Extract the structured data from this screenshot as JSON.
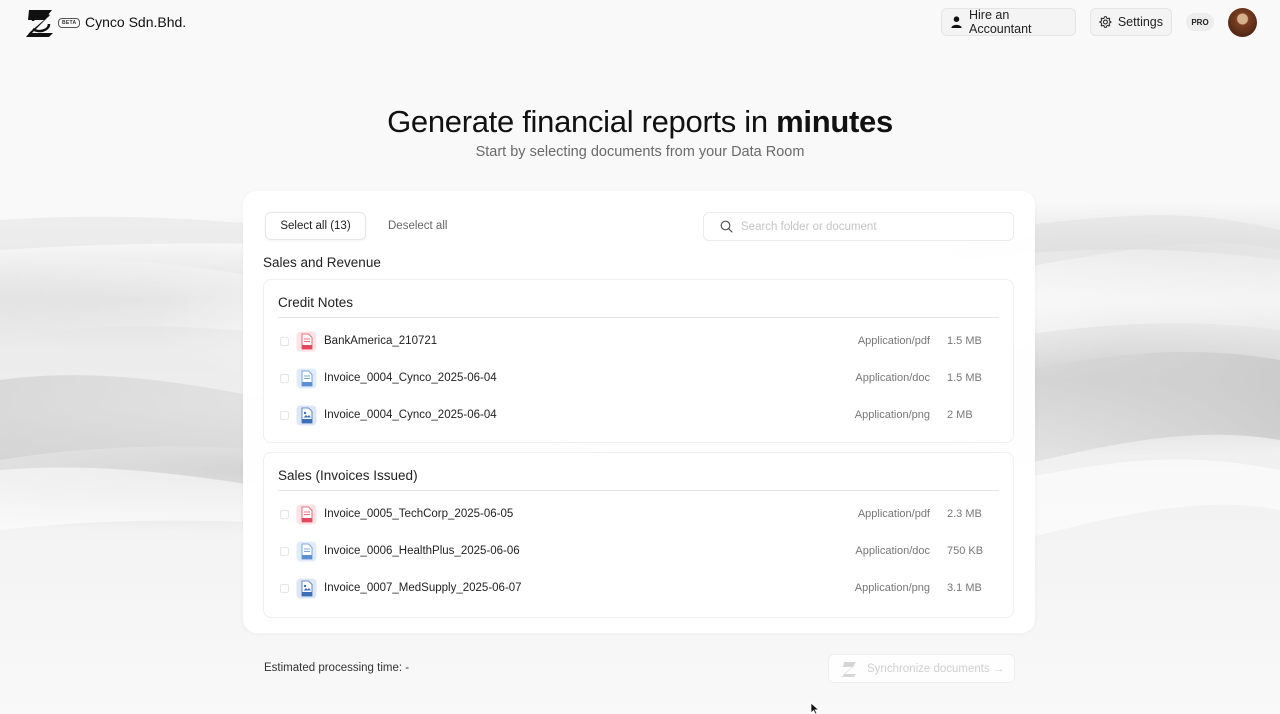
{
  "header": {
    "company_name": "Cynco Sdn.Bhd.",
    "beta_label": "BETA",
    "hire_label": "Hire an Accountant",
    "settings_label": "Settings",
    "pro_badge": "PRO"
  },
  "hero": {
    "title_prefix": "Generate financial reports in ",
    "title_emphasis": "minutes",
    "subtitle": "Start by selecting documents from your Data Room"
  },
  "toolbar": {
    "select_all_label": "Select all (13)",
    "deselect_all_label": "Deselect all",
    "search_placeholder": "Search folder or document"
  },
  "section": {
    "title": "Sales and Revenue",
    "groups": [
      {
        "title": "Credit Notes",
        "files": [
          {
            "name": "BankAmerica_210721",
            "type": "Application/pdf",
            "size": "1.5 MB",
            "icon": "pdf-file-icon"
          },
          {
            "name": "Invoice_0004_Cynco_2025-06-04",
            "type": "Application/doc",
            "size": "1.5 MB",
            "icon": "doc-file-icon"
          },
          {
            "name": "Invoice_0004_Cynco_2025-06-04",
            "type": "Application/png",
            "size": "2 MB",
            "icon": "png-file-icon"
          }
        ]
      },
      {
        "title": "Sales (Invoices Issued)",
        "files": [
          {
            "name": "Invoice_0005_TechCorp_2025-06-05",
            "type": "Application/pdf",
            "size": "2.3 MB",
            "icon": "pdf-file-icon"
          },
          {
            "name": "Invoice_0006_HealthPlus_2025-06-06",
            "type": "Application/doc",
            "size": "750 KB",
            "icon": "doc-file-icon"
          },
          {
            "name": "Invoice_0007_MedSupply_2025-06-07",
            "type": "Application/png",
            "size": "3.1 MB",
            "icon": "png-file-icon"
          }
        ]
      }
    ]
  },
  "footer": {
    "eta_label": "Estimated processing time: -",
    "sync_label": "Synchronize documents →"
  },
  "colors": {
    "pdf": "#e24a5c",
    "doc": "#5b8fd6",
    "png": "#3b6fb8",
    "background": "#f7f7f7"
  }
}
